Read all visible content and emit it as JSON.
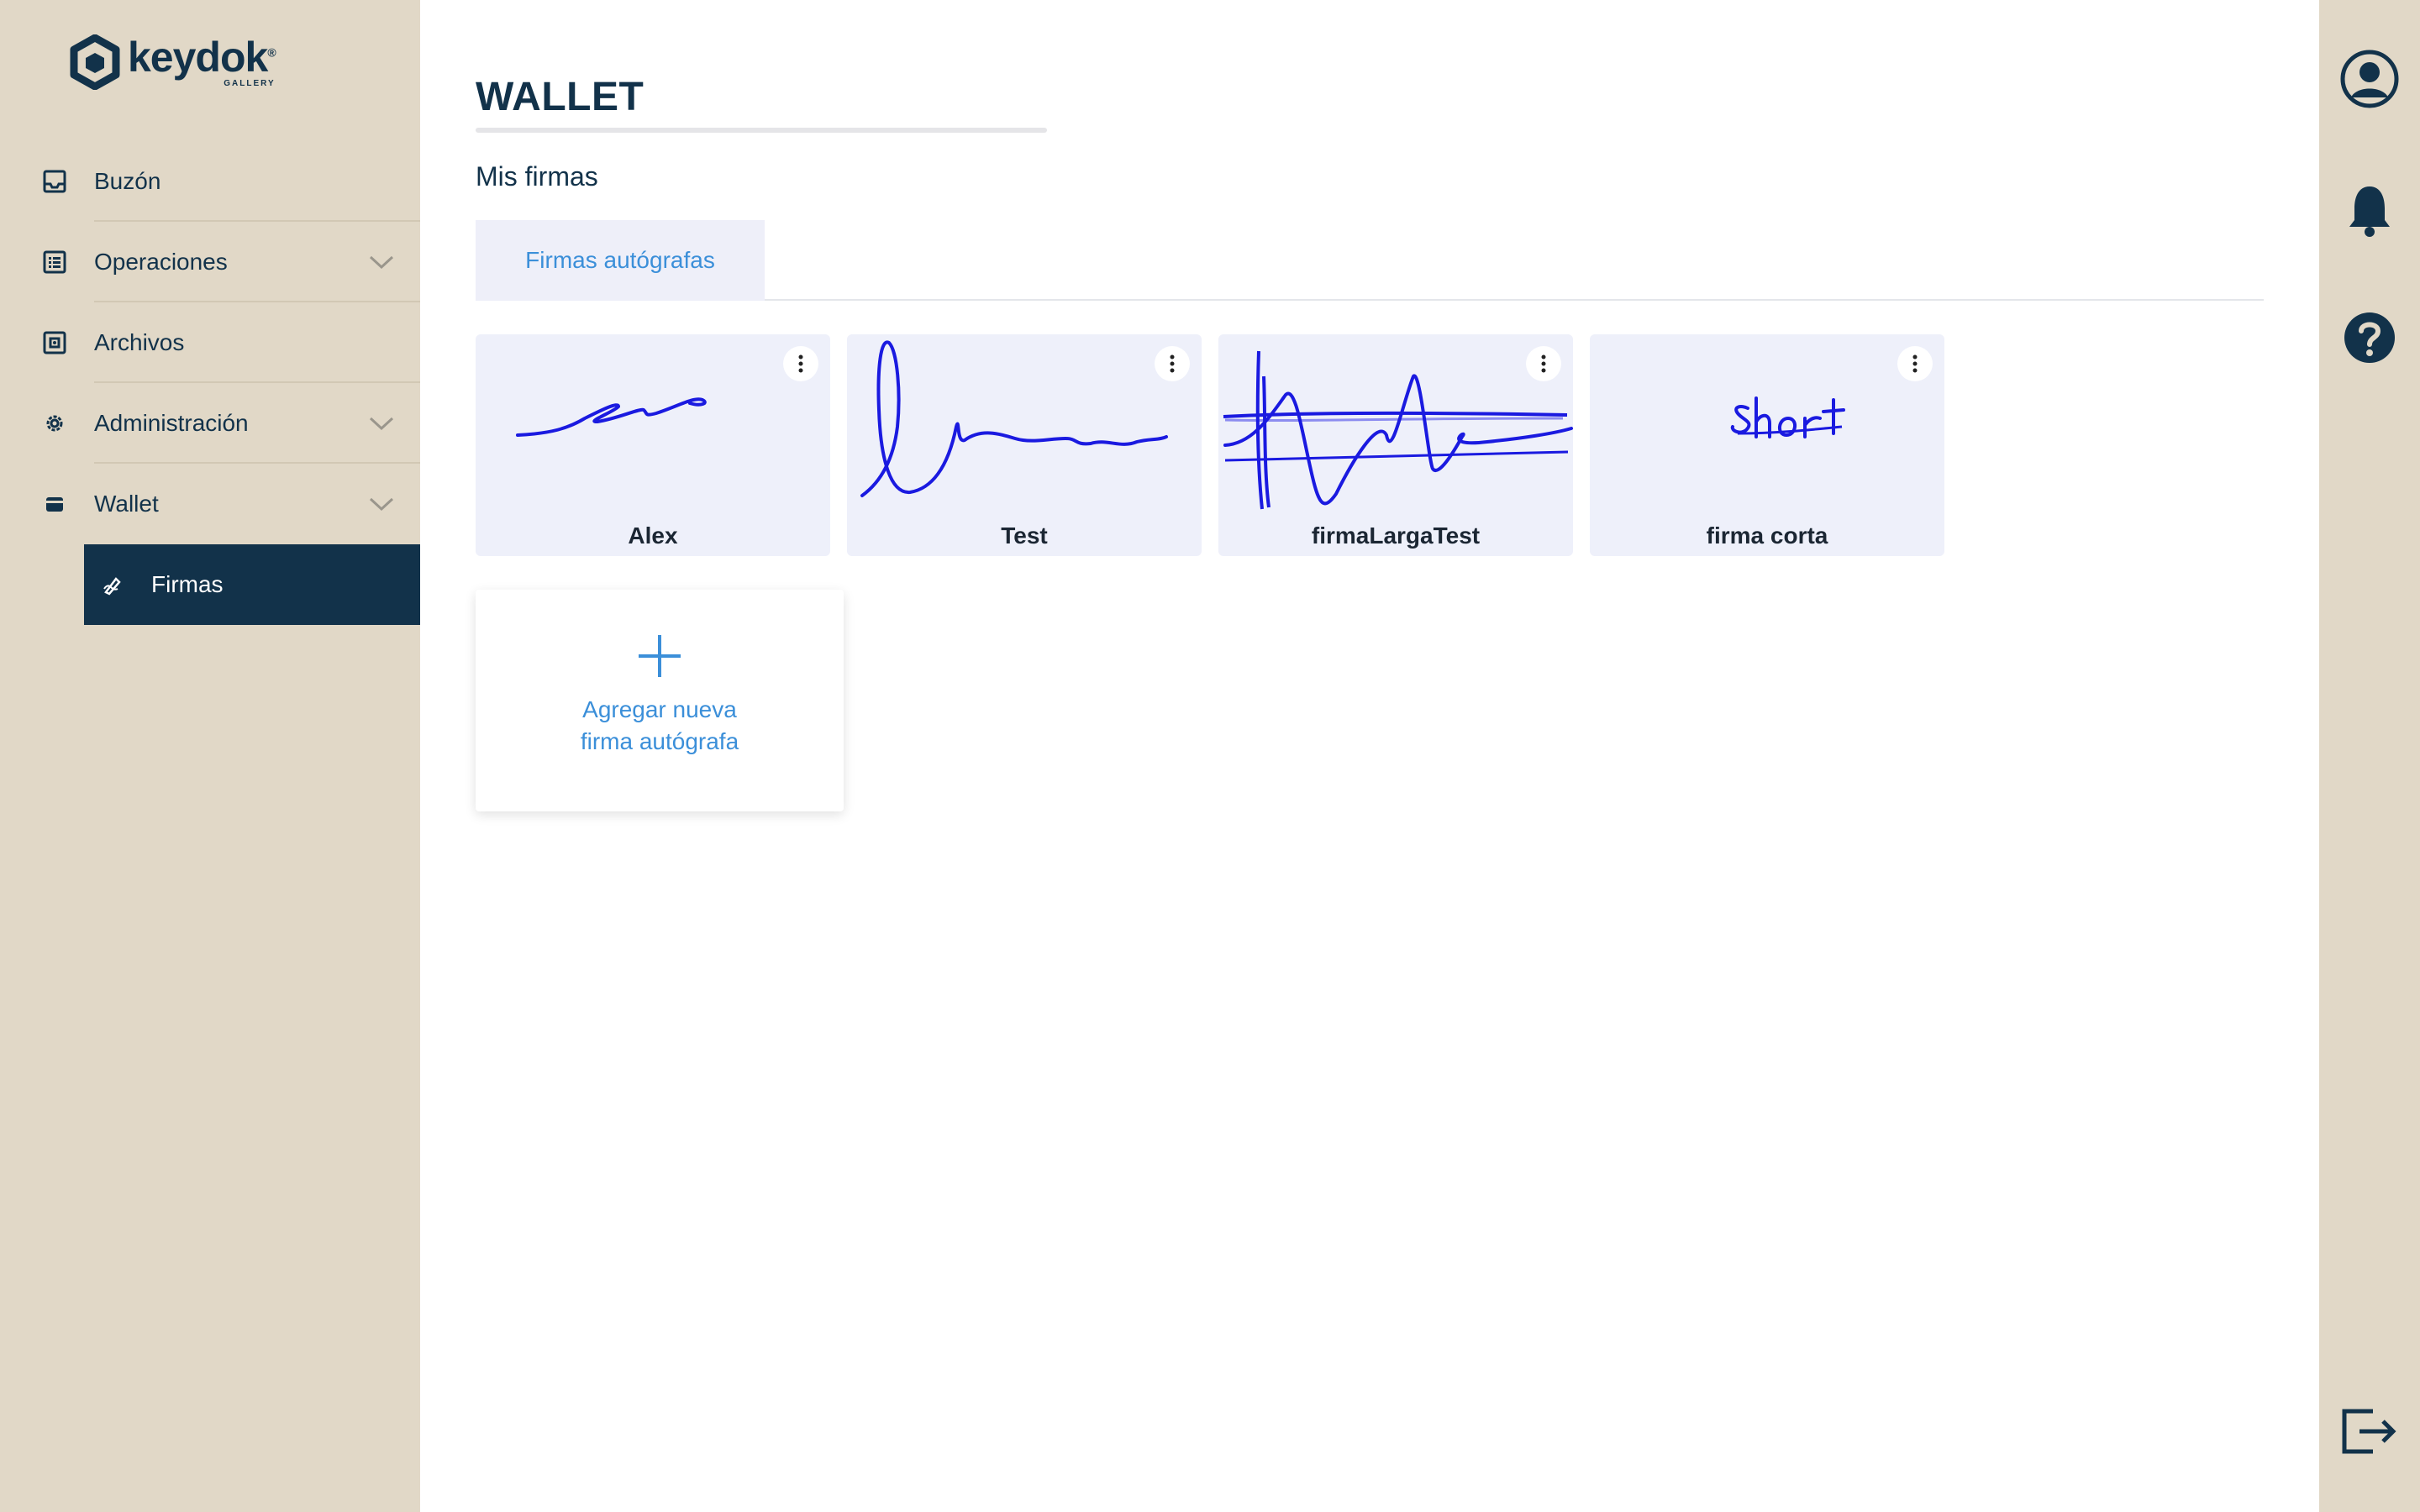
{
  "brand": {
    "name": "keydok",
    "sub": "GALLERY",
    "mark": "®"
  },
  "sidebar": {
    "items": [
      {
        "label": "Buzón",
        "icon": "inbox-icon",
        "expandable": false
      },
      {
        "label": "Operaciones",
        "icon": "list-icon",
        "expandable": true
      },
      {
        "label": "Archivos",
        "icon": "archive-icon",
        "expandable": false
      },
      {
        "label": "Administración",
        "icon": "gear-icon",
        "expandable": true
      },
      {
        "label": "Wallet",
        "icon": "wallet-icon",
        "expandable": true
      }
    ],
    "sub_item": {
      "label": "Firmas",
      "icon": "signature-icon",
      "active": true
    }
  },
  "main": {
    "title": "WALLET",
    "subtitle": "Mis firmas",
    "tabs": [
      {
        "label": "Firmas autógrafas",
        "active": true
      }
    ],
    "signatures": [
      {
        "name": "Alex"
      },
      {
        "name": "Test"
      },
      {
        "name": "firmaLargaTest"
      },
      {
        "name": "firma corta"
      }
    ],
    "add_card": {
      "label": "Agregar nueva\nfirma autógrafa"
    }
  },
  "rail": {
    "icons": [
      "user-icon",
      "bell-icon",
      "help-icon",
      "logout-icon"
    ]
  },
  "colors": {
    "sidebar_bg": "#e1d8c7",
    "primary": "#12324a",
    "accent": "#3b8fd9",
    "signature_ink": "#1a1ae0",
    "card_bg": "#eef0fa"
  }
}
